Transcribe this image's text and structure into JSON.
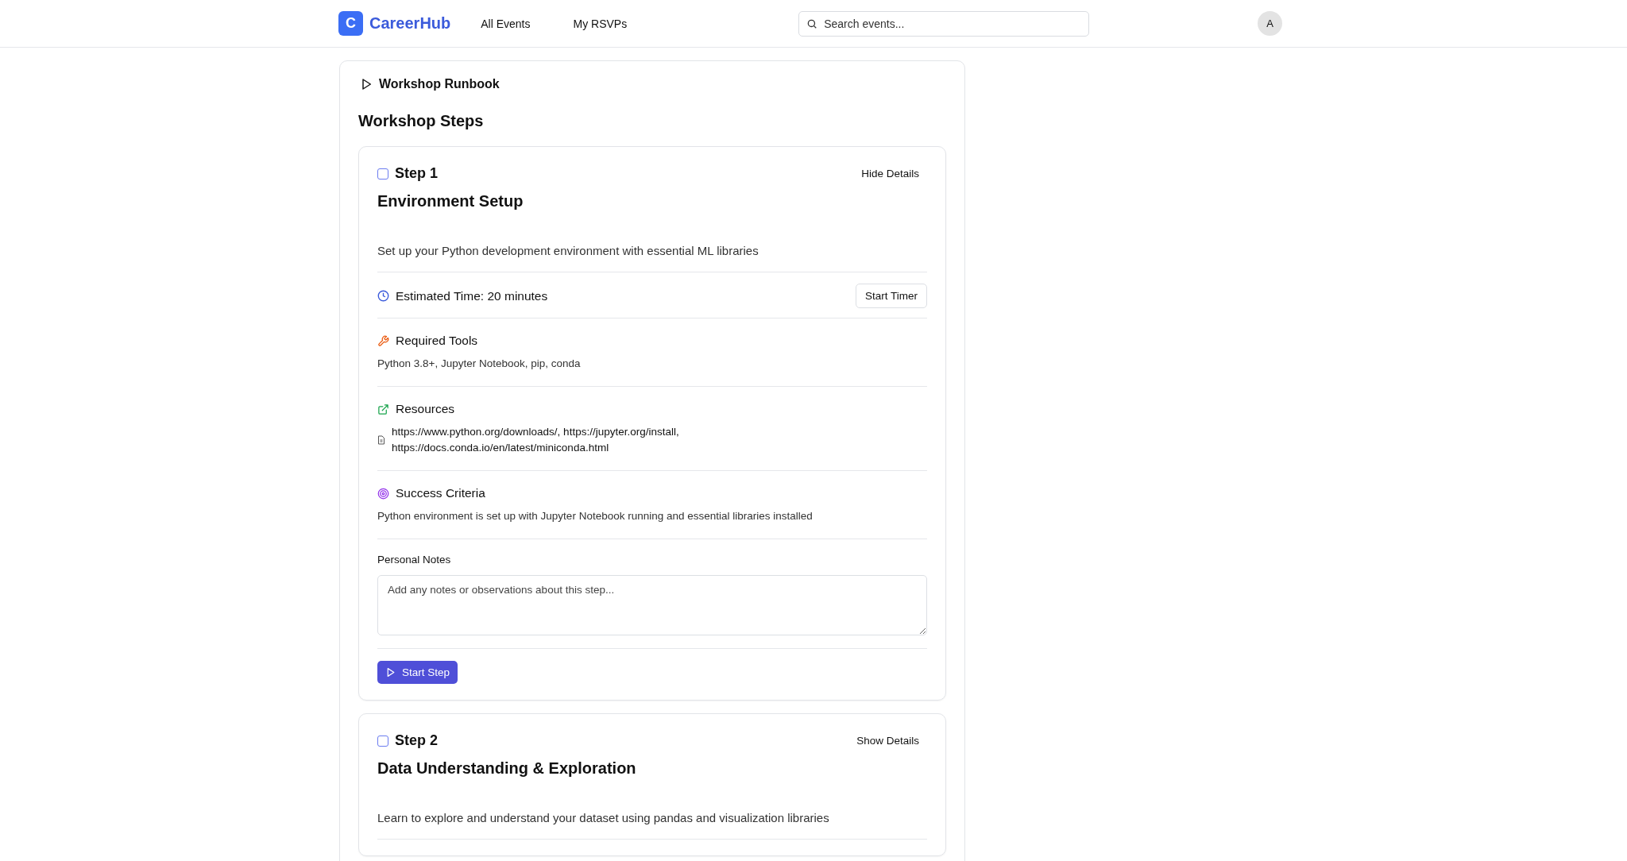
{
  "header": {
    "logo_letter": "C",
    "brand": "CareerHub",
    "nav": [
      {
        "label": "All Events",
        "selected": false
      },
      {
        "label": "My RSVPs",
        "selected": false
      }
    ],
    "search": {
      "placeholder": "Search events..."
    },
    "avatar": "A"
  },
  "runbook": {
    "title": "Workshop Runbook",
    "heading": "Workshop Steps",
    "steps": [
      {
        "label": "Step 1",
        "checked": false,
        "toggle": "Hide Details",
        "title": "Environment Setup",
        "description": "Set up your Python development environment with essential ML libraries",
        "estimated_time": "Estimated Time: 20 minutes",
        "timer_button": "Start Timer",
        "sections": [
          {
            "kind": "tools",
            "title": "Required Tools",
            "text": "Python 3.8+, Jupyter Notebook, pip, conda"
          },
          {
            "kind": "resources",
            "title": "Resources",
            "text": "https://www.python.org/downloads/, https://jupyter.org/install, https://docs.conda.io/en/latest/miniconda.html"
          },
          {
            "kind": "criteria",
            "title": "Success Criteria",
            "text": "Python environment is set up with Jupyter Notebook running and essential libraries installed"
          }
        ],
        "notes_label": "Personal Notes",
        "notes_placeholder": "Add any notes or observations about this step...",
        "start_button": "Start Step"
      },
      {
        "label": "Step 2",
        "checked": false,
        "toggle": "Show Details",
        "title": "Data Understanding & Exploration",
        "description": "Learn to explore and understand your dataset using pandas and visualization libraries"
      }
    ]
  }
}
